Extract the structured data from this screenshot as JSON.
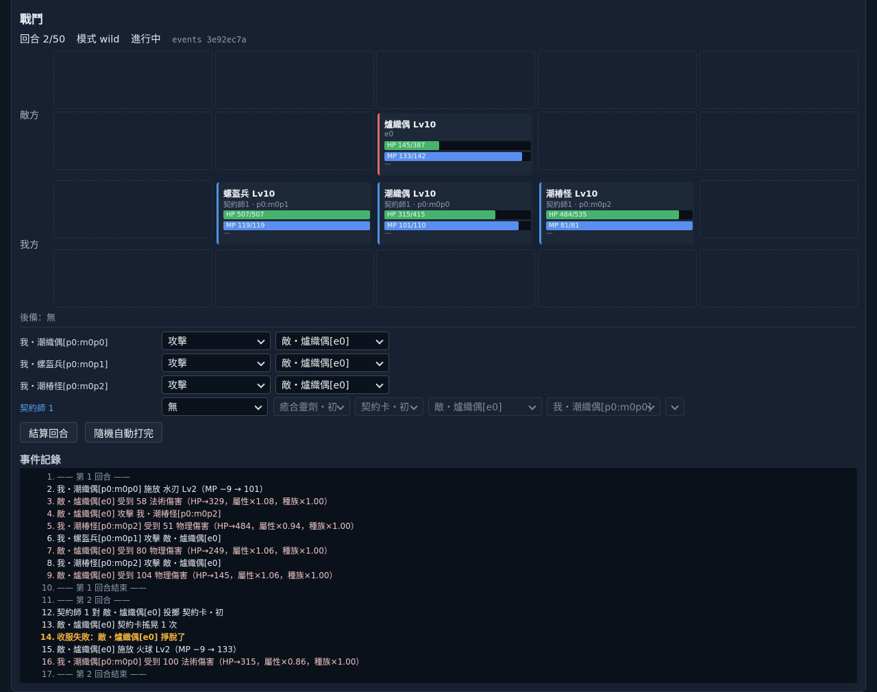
{
  "header": {
    "title": "戰鬥",
    "round": "回合 2/50",
    "mode": "模式 wild",
    "state": "進行中",
    "events": "events 3e92ec7a"
  },
  "sides": {
    "enemy": "敵方",
    "ally": "我方"
  },
  "units": {
    "e0": {
      "name": "爐織偶 Lv10",
      "sub": "e0",
      "hp_text": "HP 145/387",
      "mp_text": "MP 133/142",
      "hp_frac": 0.375,
      "mp_frac": 0.937,
      "status": "—"
    },
    "m1": {
      "name": "螺盔兵 Lv10",
      "sub": "契約師1 · p0:m0p1",
      "hp_text": "HP 507/507",
      "mp_text": "MP 119/119",
      "hp_frac": 1.0,
      "mp_frac": 1.0,
      "status": "—"
    },
    "m0": {
      "name": "潮織偶 Lv10",
      "sub": "契約師1 · p0:m0p0",
      "hp_text": "HP 315/415",
      "mp_text": "MP 101/110",
      "hp_frac": 0.759,
      "mp_frac": 0.918,
      "status": "—"
    },
    "m2": {
      "name": "潮椿怪 Lv10",
      "sub": "契約師1 · p0:m0p2",
      "hp_text": "HP 484/535",
      "mp_text": "MP 81/81",
      "hp_frac": 0.905,
      "mp_frac": 1.0,
      "status": "—"
    }
  },
  "reserve": "後備：無",
  "commands": [
    {
      "label": "我・潮織偶[p0:m0p0]",
      "action": "攻擊",
      "target": "敵・爐織偶[e0]"
    },
    {
      "label": "我・螺盔兵[p0:m0p1]",
      "action": "攻擊",
      "target": "敵・爐織偶[e0]"
    },
    {
      "label": "我・潮椿怪[p0:m0p2]",
      "action": "攻擊",
      "target": "敵・爐織偶[e0]"
    }
  ],
  "contractor": {
    "label": "契約師 1",
    "action": "無",
    "item": "癒合靈劑・初",
    "card": "契約卡・初",
    "target_enemy": "敵・爐織偶[e0]",
    "target_ally": "我・潮織偶[p0:m0p0]",
    "extra": ""
  },
  "buttons": {
    "resolve": "結算回合",
    "auto": "隨機自動打完"
  },
  "log_title": "事件記錄",
  "log": [
    {
      "n": "1.",
      "text": "—— 第 1 回合 ——",
      "kind": "sep"
    },
    {
      "n": "2.",
      "text": "我・潮織偶[p0:m0p0] 施放 水刃 Lv2（MP −9 → 101）",
      "kind": "ally"
    },
    {
      "n": "3.",
      "text": "敵・爐織偶[e0] 受到 58 法術傷害（HP→329，屬性×1.08，種族×1.00）",
      "kind": "enemy"
    },
    {
      "n": "4.",
      "text": "敵・爐織偶[e0] 攻擊 我・潮椿怪[p0:m0p2]",
      "kind": "enemy"
    },
    {
      "n": "5.",
      "text": "我・潮椿怪[p0:m0p2] 受到 51 物理傷害（HP→484，屬性×0.94，種族×1.00）",
      "kind": "enemy"
    },
    {
      "n": "6.",
      "text": "我・螺盔兵[p0:m0p1] 攻擊 敵・爐織偶[e0]",
      "kind": "ally"
    },
    {
      "n": "7.",
      "text": "敵・爐織偶[e0] 受到 80 物理傷害（HP→249，屬性×1.06，種族×1.00）",
      "kind": "enemy"
    },
    {
      "n": "8.",
      "text": "我・潮椿怪[p0:m0p2] 攻擊 敵・爐織偶[e0]",
      "kind": "ally"
    },
    {
      "n": "9.",
      "text": "敵・爐織偶[e0] 受到 104 物理傷害（HP→145，屬性×1.06，種族×1.00）",
      "kind": "enemy"
    },
    {
      "n": "10.",
      "text": "—— 第 1 回合結束 ——",
      "kind": "sep"
    },
    {
      "n": "11.",
      "text": "—— 第 2 回合 ——",
      "kind": "sep"
    },
    {
      "n": "12.",
      "text": "契約師 1 對 敵・爐織偶[e0] 投擲 契約卡・初",
      "kind": "ally"
    },
    {
      "n": "13.",
      "text": "敵・爐織偶[e0] 契約卡搖晃 1 次",
      "kind": "ally"
    },
    {
      "n": "14.",
      "text": "收服失敗：敵・爐織偶[e0] 掙脫了",
      "kind": "fail"
    },
    {
      "n": "15.",
      "text": "敵・爐織偶[e0] 施放 火球 Lv2（MP −9 → 133）",
      "kind": "ally"
    },
    {
      "n": "16.",
      "text": "我・潮織偶[p0:m0p0] 受到 100 法術傷害（HP→315，屬性×0.86，種族×1.00）",
      "kind": "enemy"
    },
    {
      "n": "17.",
      "text": "—— 第 2 回合結束 ——",
      "kind": "sep"
    }
  ]
}
